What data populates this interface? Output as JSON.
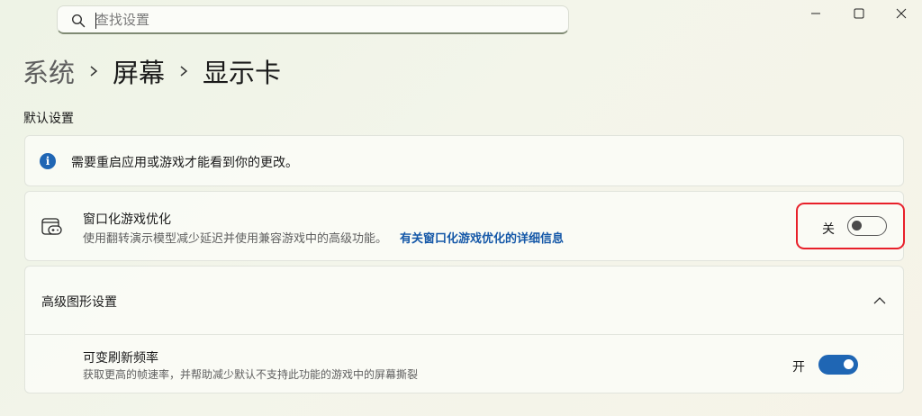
{
  "search": {
    "placeholder": "查找设置"
  },
  "window_controls": [
    "minimize-icon",
    "maximize-icon",
    "close-icon"
  ],
  "breadcrumb": {
    "root": "系统",
    "middle": "屏幕",
    "current": "显示卡"
  },
  "section": {
    "title": "默认设置"
  },
  "info_bar": {
    "icon": "info-icon",
    "text": "需要重启应用或游戏才能看到你的更改。"
  },
  "windowed_optimization": {
    "icon": "gamepad-window-icon",
    "title": "窗口化游戏优化",
    "description": "使用翻转演示模型减少延迟并使用兼容游戏中的高级功能。",
    "link": "有关窗口化游戏优化的详细信息",
    "state_label": "关",
    "enabled": false
  },
  "advanced": {
    "title": "高级图形设置",
    "expanded": true,
    "variable_refresh": {
      "title": "可变刷新频率",
      "description": "获取更高的帧速率，并帮助减少默认不支持此功能的游戏中的屏幕撕裂",
      "state_label": "开",
      "enabled": true
    }
  },
  "colors": {
    "accent": "#1f66b4",
    "link": "#1558a8",
    "highlight_border": "#e8202a"
  }
}
